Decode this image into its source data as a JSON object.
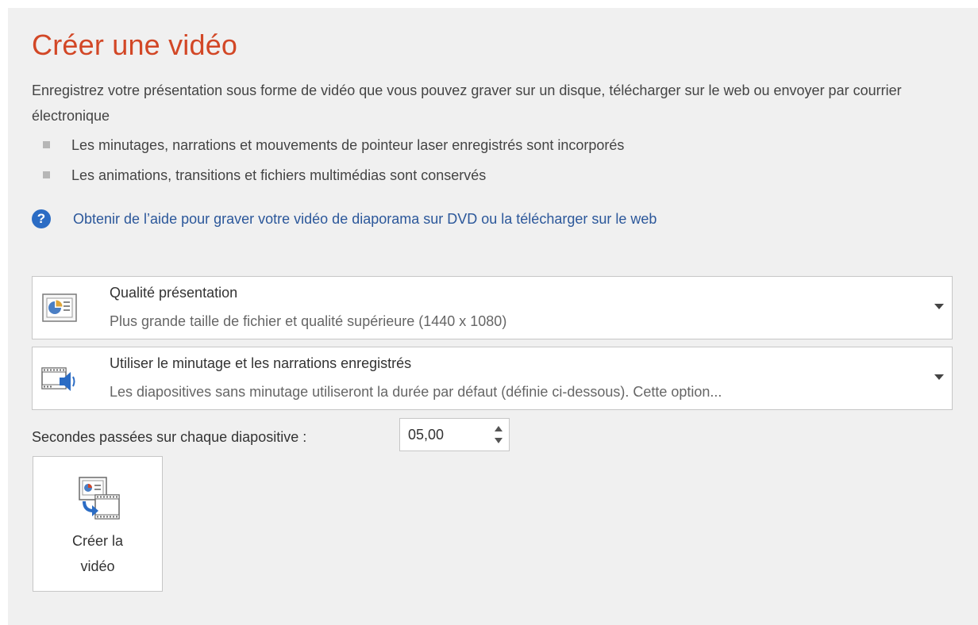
{
  "page": {
    "title": "Créer une vidéo",
    "description": "Enregistrez votre présentation sous forme de vidéo que vous pouvez graver sur un disque, télécharger sur le web ou envoyer par courrier électronique",
    "bullets": [
      "Les minutages, narrations et mouvements de pointeur laser enregistrés sont incorporés",
      "Les animations, transitions et fichiers multimédias sont conservés"
    ],
    "help_link": "Obtenir de l’aide pour graver votre vidéo de diaporama sur DVD ou la télécharger sur le web"
  },
  "quality_dropdown": {
    "title": "Qualité présentation",
    "subtitle": "Plus grande taille de fichier et qualité supérieure (1440 x 1080)",
    "icon": "presentation-quality-icon"
  },
  "timing_dropdown": {
    "title": "Utiliser le minutage et les narrations enregistrés",
    "subtitle": "Les diapositives sans minutage utiliseront la durée par défaut (définie ci-dessous). Cette option...",
    "icon": "timing-narration-icon"
  },
  "seconds": {
    "label": "Secondes passées sur chaque diapositive :",
    "value": "05,00"
  },
  "create_button": {
    "line1": "Créer la",
    "line2": "vidéo",
    "icon": "create-video-icon"
  },
  "colors": {
    "title": "#d24726",
    "link": "#2b579a",
    "help_icon": "#2b6cc4",
    "panel_background": "#f0f0f0"
  }
}
